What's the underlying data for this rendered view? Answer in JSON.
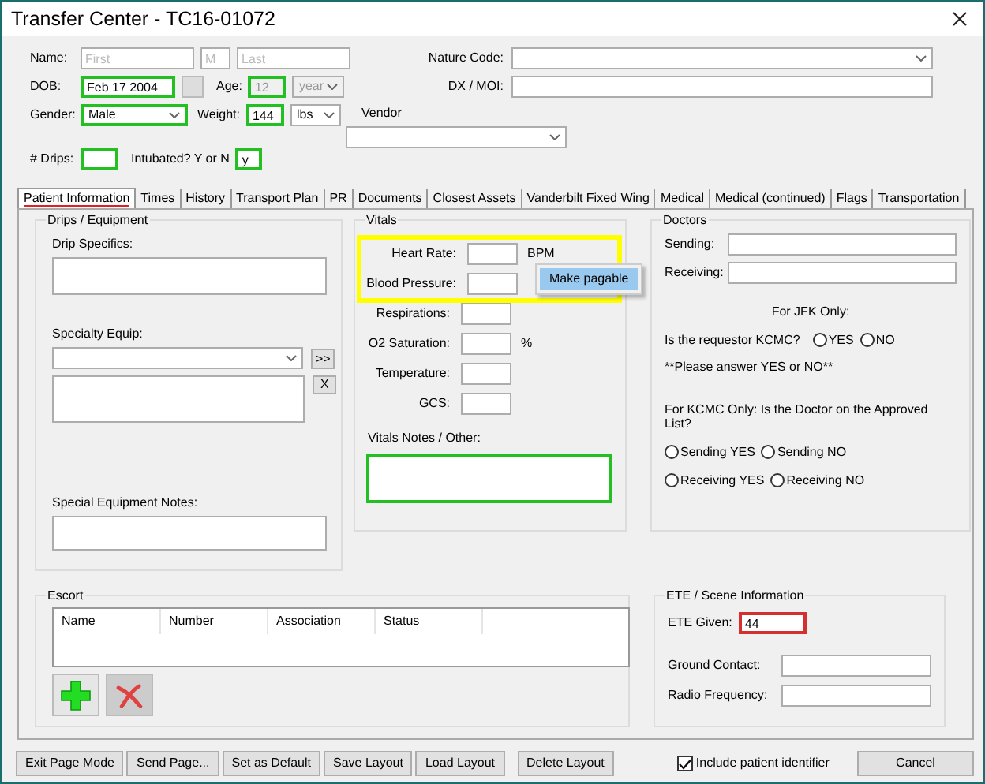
{
  "window": {
    "title": "Transfer Center - TC16-01072"
  },
  "header": {
    "name": {
      "label": "Name:",
      "first": {
        "placeholder": "First"
      },
      "middle": {
        "placeholder": "M"
      },
      "last": {
        "placeholder": "Last"
      }
    },
    "dob": {
      "label": "DOB:",
      "value": "Feb 17 2004",
      "valid": true
    },
    "age": {
      "label": "Age:",
      "value": "12",
      "unit": "year",
      "disabled": true,
      "valid": true
    },
    "gender": {
      "label": "Gender:",
      "value": "Male",
      "valid": true
    },
    "weight": {
      "label": "Weight:",
      "value": "144",
      "unit": "lbs",
      "valid": true
    },
    "drips": {
      "label": "# Drips:",
      "valid": true
    },
    "intubated": {
      "label": "Intubated? Y or N",
      "value": "y",
      "valid": true
    },
    "nature_code": {
      "label": "Nature Code:"
    },
    "dx_moi": {
      "label": "DX / MOI:"
    },
    "vendor": {
      "label": "Vendor"
    }
  },
  "tabs": [
    {
      "label": "Patient Information",
      "selected": true
    },
    {
      "label": "Times",
      "selected": false
    },
    {
      "label": "History",
      "selected": false
    },
    {
      "label": "Transport Plan",
      "selected": false
    },
    {
      "label": "PR",
      "selected": false
    },
    {
      "label": "Documents",
      "selected": false
    },
    {
      "label": "Closest Assets",
      "selected": false
    },
    {
      "label": "Vanderbilt Fixed Wing",
      "selected": false
    },
    {
      "label": "Medical",
      "selected": false
    },
    {
      "label": "Medical (continued)",
      "selected": false
    },
    {
      "label": "Flags",
      "selected": false
    },
    {
      "label": "Transportation",
      "selected": false
    }
  ],
  "drips_equipment": {
    "title": "Drips / Equipment",
    "drip_specifics_label": "Drip Specifics:",
    "specialty_equip_label": "Specialty Equip:",
    "add_button": ">>",
    "remove_button": "X",
    "notes_label": "Special Equipment Notes:"
  },
  "vitals": {
    "title": "Vitals",
    "fields": [
      {
        "label": "Heart Rate:",
        "unit": "BPM",
        "highlighted": true
      },
      {
        "label": "Blood Pressure:",
        "highlighted": true
      },
      {
        "label": "Respirations:",
        "highlighted": false
      },
      {
        "label": "O2 Saturation:",
        "unit": "%",
        "highlighted": false
      },
      {
        "label": "Temperature:",
        "highlighted": false
      },
      {
        "label": "GCS:",
        "highlighted": false
      }
    ],
    "notes_label": "Vitals Notes / Other:",
    "notes_valid": true
  },
  "doctors": {
    "title": "Doctors",
    "sending_label": "Sending:",
    "receiving_label": "Receiving:",
    "jfk_heading": "For JFK Only:",
    "jfk_question": "Is the requestor KCMC?",
    "jfk_options": [
      {
        "label": "YES",
        "selected": false
      },
      {
        "label": "NO",
        "selected": false
      }
    ],
    "jfk_note": "**Please answer YES or NO**",
    "kcmc_question": "For KCMC Only: Is the Doctor on the Approved List?",
    "kcmc_options": [
      {
        "label": "Sending YES",
        "selected": false
      },
      {
        "label": "Sending NO",
        "selected": false
      },
      {
        "label": "Receiving YES",
        "selected": false
      },
      {
        "label": "Receiving NO",
        "selected": false
      }
    ]
  },
  "context_menu": {
    "items": [
      {
        "label": "Make pagable",
        "selected": true
      }
    ]
  },
  "escort": {
    "title": "Escort",
    "columns": [
      "Name",
      "Number",
      "Association",
      "Status"
    ],
    "buttons": [
      {
        "kind": "add",
        "disabled": false
      },
      {
        "kind": "delete",
        "disabled": true
      }
    ]
  },
  "ete": {
    "title": "ETE / Scene Information",
    "ete_given": {
      "label": "ETE Given:",
      "value": "44",
      "valid": false
    },
    "ground_contact": {
      "label": "Ground Contact:"
    },
    "radio_frequency": {
      "label": "Radio Frequency:"
    }
  },
  "footer": {
    "buttons": [
      "Exit Page Mode",
      "Send Page...",
      "Set as Default",
      "Save Layout",
      "Load Layout",
      "Delete Layout"
    ],
    "include_identifier": {
      "label": "Include patient identifier",
      "checked": true
    },
    "cancel": "Cancel"
  }
}
